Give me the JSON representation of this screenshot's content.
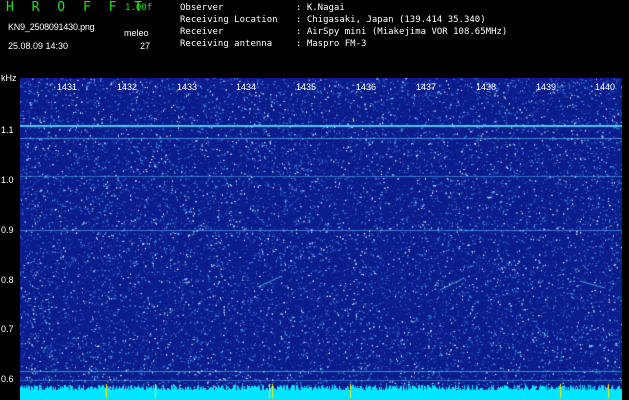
{
  "header": {
    "brand": "H R O F F T",
    "version": "1.00f",
    "filename": "KN9_2508091430.png",
    "user": "meleo",
    "datetime": "25.08.09 14:30",
    "count": "27"
  },
  "info": [
    {
      "label": "Observer",
      "value": ": K.Nagai"
    },
    {
      "label": "Receiving Location",
      "value": ": Chigasaki, Japan (139.414 35.340)"
    },
    {
      "label": "Receiver",
      "value": ": AirSpy mini (Miakejima VOR 108.65MHz)"
    },
    {
      "label": "Receiving antenna",
      "value": ": Maspro FM-3"
    }
  ],
  "axis": {
    "unit": "kHz",
    "minutes": [
      "1431",
      "1432",
      "1433",
      "1434",
      "1435",
      "1436",
      "1437",
      "1438",
      "1439",
      "1440"
    ],
    "yticks": [
      "1.1",
      "1.0",
      "0.9",
      "0.8",
      "0.7",
      "0.6"
    ]
  },
  "colors": {
    "background": "#000000",
    "header_green": "#22dd22",
    "text": "#ffffff",
    "spectrogram_base": "#0b1c8c",
    "carrier": "#5fe0ff",
    "noise_floor": "#00e5ff",
    "spike": "#ffee00"
  }
}
